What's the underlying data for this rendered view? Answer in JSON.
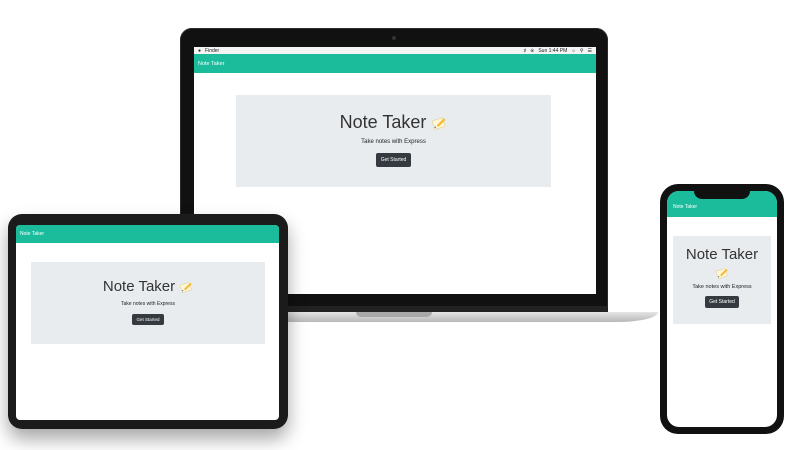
{
  "mac_menubar": {
    "app_name": "Finder",
    "clock": "Sun 1:44 PM"
  },
  "app": {
    "navbar_title": "Note Taker",
    "jumbotron_title": "Note Taker",
    "tagline": "Take notes with Express",
    "cta_label": "Get Started"
  },
  "colors": {
    "navbar": "#1abc9c",
    "jumbotron": "#e9ecef",
    "button": "#343a40"
  },
  "icons": {
    "title_icon": "pencil-memo-icon",
    "menubar": [
      "apple-icon",
      "volume-icon",
      "bluetooth-icon",
      "wifi-icon",
      "search-icon",
      "menu-list-icon"
    ]
  }
}
